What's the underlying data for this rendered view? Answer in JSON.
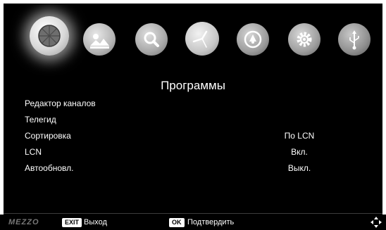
{
  "menu": {
    "icons": [
      {
        "name": "channels-icon",
        "selected": true
      },
      {
        "name": "picture-icon",
        "selected": false
      },
      {
        "name": "search-icon",
        "selected": false
      },
      {
        "name": "clock-icon",
        "selected": false
      },
      {
        "name": "lock-icon",
        "selected": false
      },
      {
        "name": "gear-icon",
        "selected": false
      },
      {
        "name": "usb-icon",
        "selected": false
      }
    ],
    "title": "Программы",
    "items": [
      {
        "label": "Редактор каналов",
        "value": ""
      },
      {
        "label": "Телегид",
        "value": ""
      },
      {
        "label": "Сортировка",
        "value": "По LCN"
      },
      {
        "label": "LCN",
        "value": "Вкл."
      },
      {
        "label": "Автообновл.",
        "value": "Выкл."
      }
    ]
  },
  "footer": {
    "logo": "MEZZO",
    "exit_key": "EXIT",
    "exit_label": "Выход",
    "ok_key": "OK",
    "ok_label": "Подтвердить"
  }
}
